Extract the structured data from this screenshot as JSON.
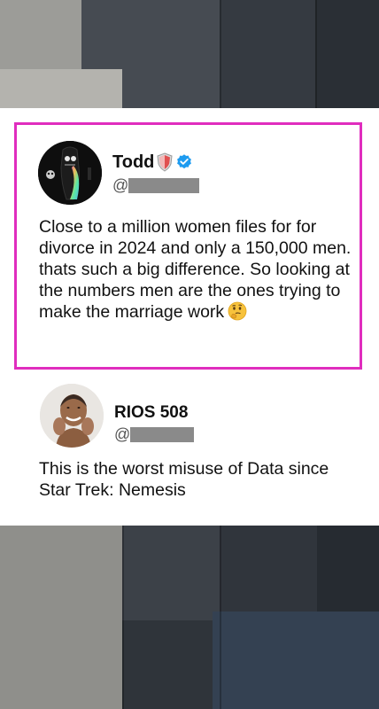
{
  "posts": [
    {
      "name": "Todd",
      "handle_prefix": "@",
      "text": "Close to a million women files for for divorce in 2024 and only a 150,000 men. thats such a big difference. So looking at the numbers men are the ones trying to make the marriage work",
      "emoji": "thinking-face-icon",
      "verified": true,
      "badge": "shield-icon",
      "highlighted": true,
      "highlight_color": "#e02dbe"
    },
    {
      "name": "RIOS 508",
      "handle_prefix": "@",
      "text": "This is the worst misuse of Data since Star Trek: Nemesis",
      "verified": false,
      "highlighted": false
    }
  ],
  "colors": {
    "verified": "#1d9bf0",
    "redaction": "#8a8a8a"
  }
}
